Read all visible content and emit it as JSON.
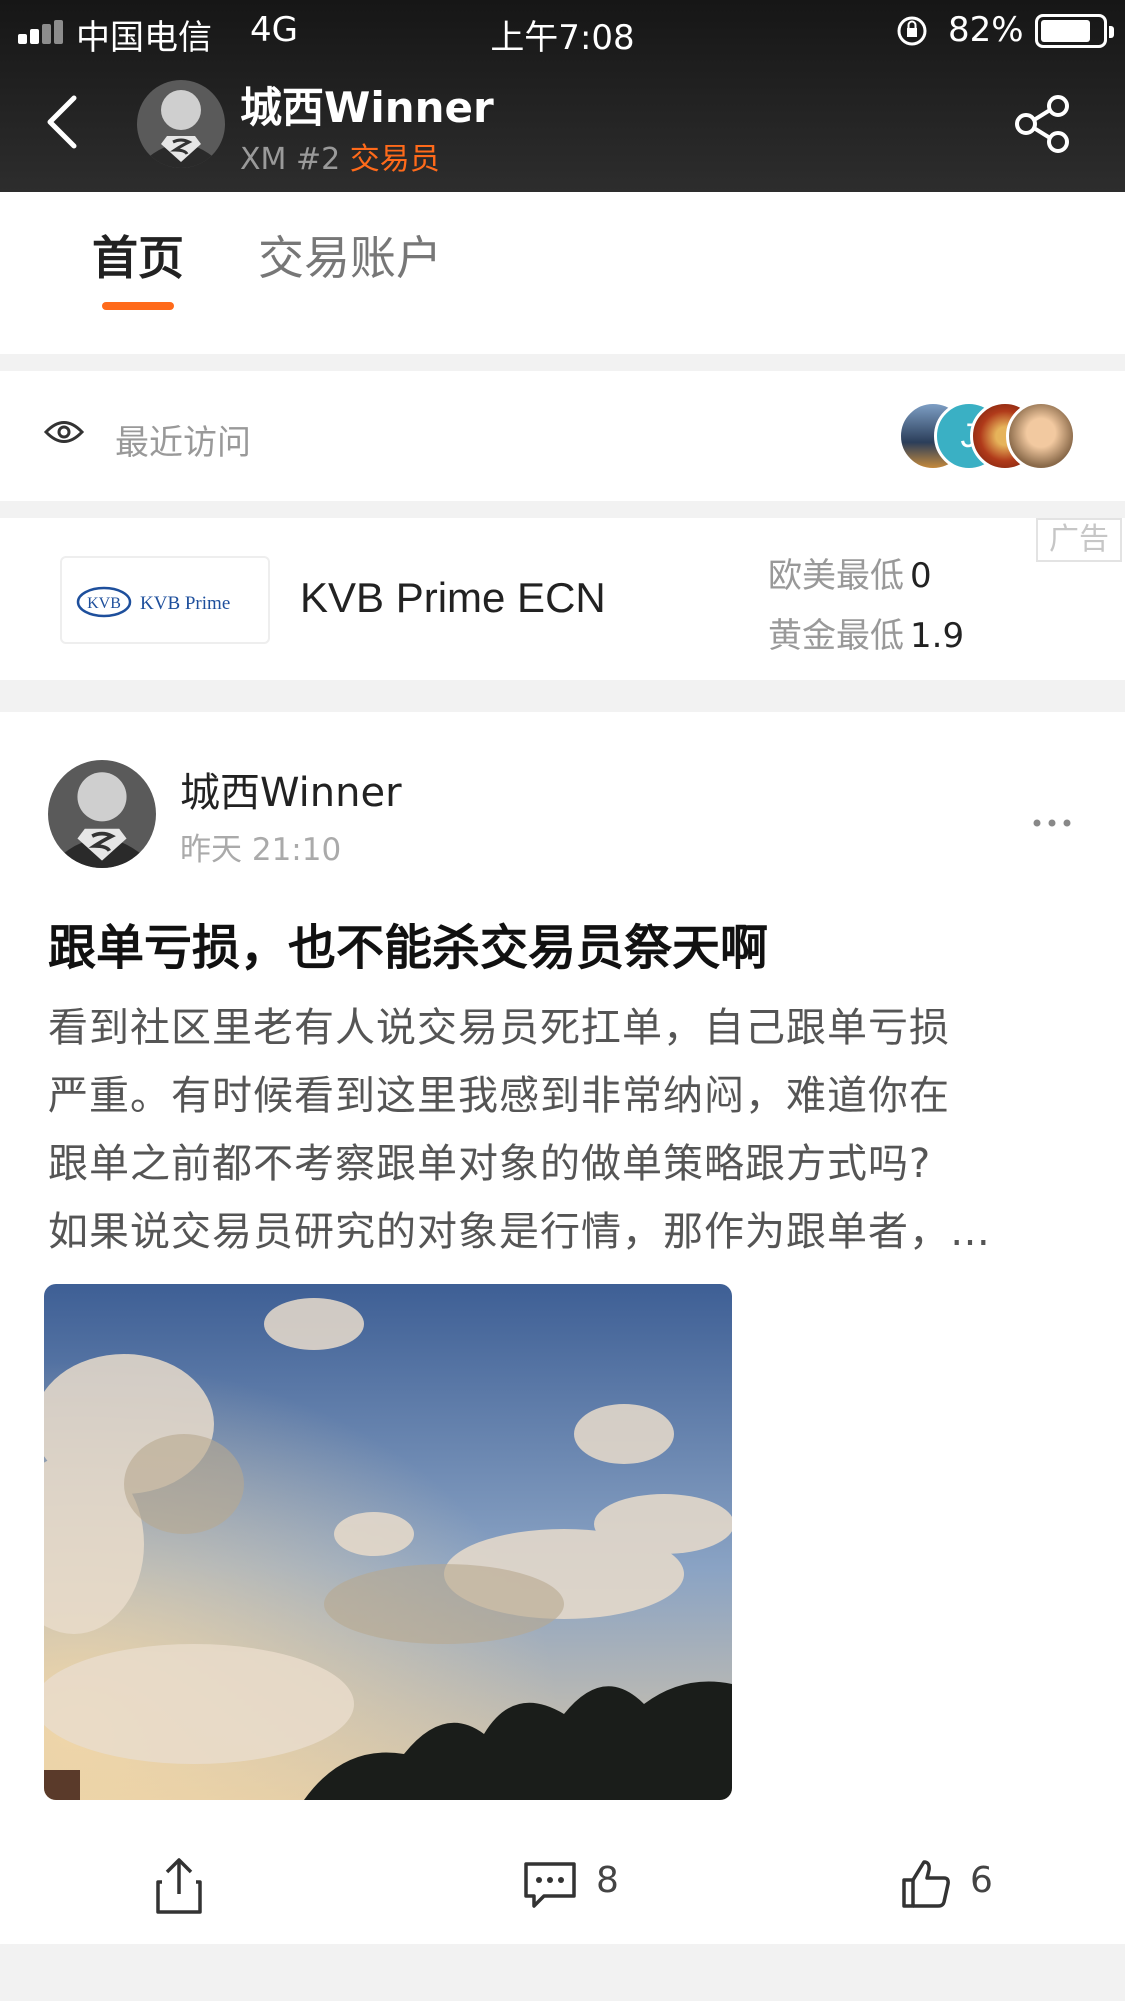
{
  "status_bar": {
    "carrier": "中国电信",
    "network": "4G",
    "time": "上午7:08",
    "battery_percent": "82%",
    "battery_level": 0.82
  },
  "header": {
    "user_name": "城西Winner",
    "broker": "XM",
    "rank": "#2",
    "role": "交易员",
    "icons": [
      "back-icon",
      "avatar",
      "share-icon"
    ],
    "role_color": "#ff6a1a"
  },
  "tabs": [
    {
      "label": "首页",
      "active": true
    },
    {
      "label": "交易账户",
      "active": false
    }
  ],
  "recent_visits": {
    "label": "最近访问",
    "visitor_letter": "J"
  },
  "ad": {
    "logo_text": "KVB Prime",
    "logo_mark": "KVB",
    "broker_name": "KVB Prime ECN",
    "spread_label_1": "欧美最低",
    "spread_value_1": "0",
    "spread_label_2": "黄金最低",
    "spread_value_2": "1.9",
    "tag": "广告"
  },
  "post": {
    "author": "城西Winner",
    "time": "昨天 21:10",
    "title": "跟单亏损，也不能杀交易员祭天啊",
    "body_lines": [
      "看到社区里老有人说交易员死扛单，自己跟单亏损",
      "严重。有时候看到这里我感到非常纳闷，难道你在",
      "跟单之前都不考察跟单对象的做单策略跟方式吗?",
      "如果说交易员研究的对象是行情，那作为跟单者，…"
    ],
    "comments": "8",
    "likes": "6"
  },
  "colors": {
    "accent": "#ff6a1a",
    "header_bg": "#1f1f1f"
  }
}
